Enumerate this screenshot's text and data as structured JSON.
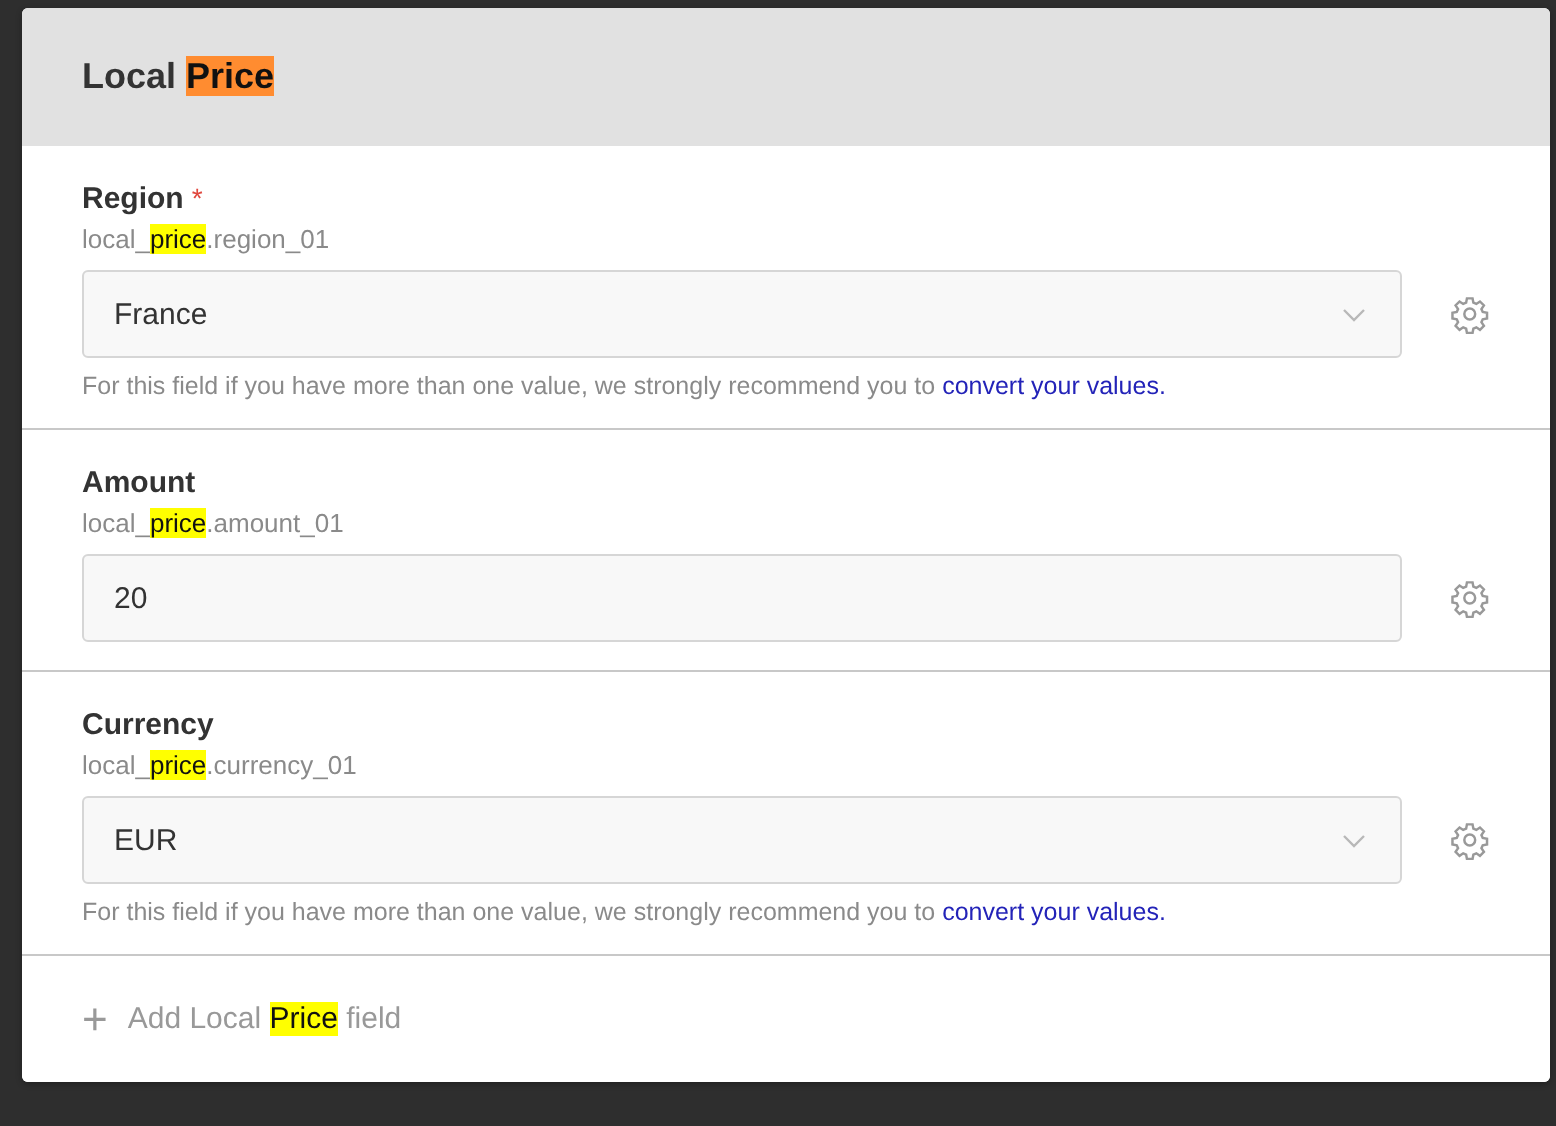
{
  "panel": {
    "title": [
      {
        "text": "Local ",
        "highlighted": false
      },
      {
        "text": "Price",
        "highlighted": true,
        "color": "#ff8c30"
      }
    ]
  },
  "fields": [
    {
      "kind": "select",
      "label": "Region",
      "required_mark": "*",
      "key": [
        {
          "text": "local_",
          "highlighted": false
        },
        {
          "text": "price",
          "highlighted": true,
          "color": "#ffff00"
        },
        {
          "text": ".region_01",
          "highlighted": false
        }
      ],
      "value": "France",
      "hint": {
        "text": "For this field if you have more than one value, we strongly recommend you to",
        "link": "convert your values."
      }
    },
    {
      "kind": "text",
      "label": "Amount",
      "key": [
        {
          "text": "local_",
          "highlighted": false
        },
        {
          "text": "price",
          "highlighted": true,
          "color": "#ffff00"
        },
        {
          "text": ".amount_01",
          "highlighted": false
        }
      ],
      "value": "20"
    },
    {
      "kind": "select",
      "label": "Currency",
      "key": [
        {
          "text": "local_",
          "highlighted": false
        },
        {
          "text": "price",
          "highlighted": true,
          "color": "#ffff00"
        },
        {
          "text": ".currency_01",
          "highlighted": false
        }
      ],
      "value": "EUR",
      "hint": {
        "text": "For this field if you have more than one value, we strongly recommend you to",
        "link": "convert your values."
      }
    }
  ],
  "add_field": {
    "icon": "+",
    "label": [
      {
        "text": "Add Local ",
        "highlighted": false
      },
      {
        "text": "Price",
        "highlighted": true,
        "color": "#ffff00"
      },
      {
        "text": " field",
        "highlighted": false
      }
    ]
  }
}
